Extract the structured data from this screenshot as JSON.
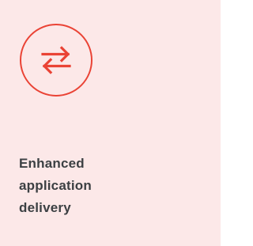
{
  "card": {
    "icon": "swap-arrows-icon",
    "accent_color": "#ea4335",
    "background_color": "#fce8e8",
    "title_lines": [
      "Enhanced",
      "application",
      "delivery"
    ]
  }
}
